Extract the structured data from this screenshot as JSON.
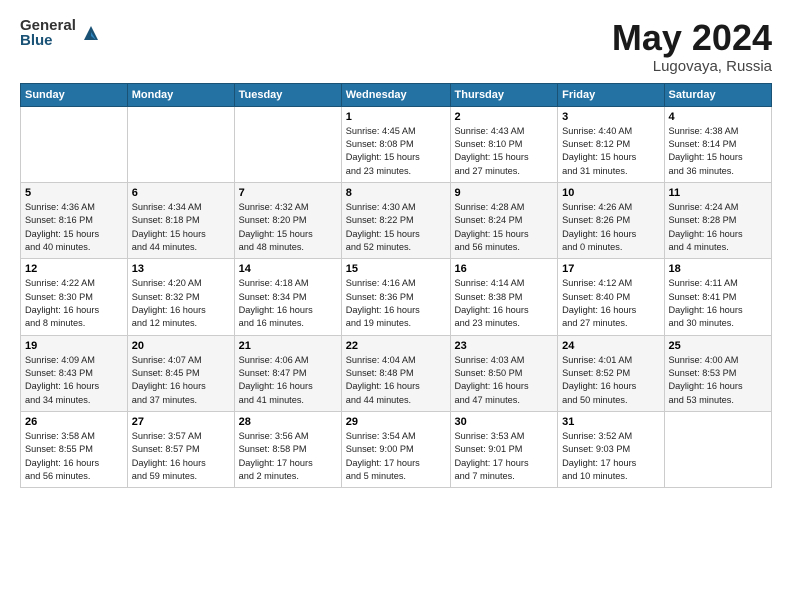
{
  "header": {
    "logo_general": "General",
    "logo_blue": "Blue",
    "month_year": "May 2024",
    "location": "Lugovaya, Russia"
  },
  "weekdays": [
    "Sunday",
    "Monday",
    "Tuesday",
    "Wednesday",
    "Thursday",
    "Friday",
    "Saturday"
  ],
  "weeks": [
    [
      {
        "day": "",
        "info": ""
      },
      {
        "day": "",
        "info": ""
      },
      {
        "day": "",
        "info": ""
      },
      {
        "day": "1",
        "info": "Sunrise: 4:45 AM\nSunset: 8:08 PM\nDaylight: 15 hours\nand 23 minutes."
      },
      {
        "day": "2",
        "info": "Sunrise: 4:43 AM\nSunset: 8:10 PM\nDaylight: 15 hours\nand 27 minutes."
      },
      {
        "day": "3",
        "info": "Sunrise: 4:40 AM\nSunset: 8:12 PM\nDaylight: 15 hours\nand 31 minutes."
      },
      {
        "day": "4",
        "info": "Sunrise: 4:38 AM\nSunset: 8:14 PM\nDaylight: 15 hours\nand 36 minutes."
      }
    ],
    [
      {
        "day": "5",
        "info": "Sunrise: 4:36 AM\nSunset: 8:16 PM\nDaylight: 15 hours\nand 40 minutes."
      },
      {
        "day": "6",
        "info": "Sunrise: 4:34 AM\nSunset: 8:18 PM\nDaylight: 15 hours\nand 44 minutes."
      },
      {
        "day": "7",
        "info": "Sunrise: 4:32 AM\nSunset: 8:20 PM\nDaylight: 15 hours\nand 48 minutes."
      },
      {
        "day": "8",
        "info": "Sunrise: 4:30 AM\nSunset: 8:22 PM\nDaylight: 15 hours\nand 52 minutes."
      },
      {
        "day": "9",
        "info": "Sunrise: 4:28 AM\nSunset: 8:24 PM\nDaylight: 15 hours\nand 56 minutes."
      },
      {
        "day": "10",
        "info": "Sunrise: 4:26 AM\nSunset: 8:26 PM\nDaylight: 16 hours\nand 0 minutes."
      },
      {
        "day": "11",
        "info": "Sunrise: 4:24 AM\nSunset: 8:28 PM\nDaylight: 16 hours\nand 4 minutes."
      }
    ],
    [
      {
        "day": "12",
        "info": "Sunrise: 4:22 AM\nSunset: 8:30 PM\nDaylight: 16 hours\nand 8 minutes."
      },
      {
        "day": "13",
        "info": "Sunrise: 4:20 AM\nSunset: 8:32 PM\nDaylight: 16 hours\nand 12 minutes."
      },
      {
        "day": "14",
        "info": "Sunrise: 4:18 AM\nSunset: 8:34 PM\nDaylight: 16 hours\nand 16 minutes."
      },
      {
        "day": "15",
        "info": "Sunrise: 4:16 AM\nSunset: 8:36 PM\nDaylight: 16 hours\nand 19 minutes."
      },
      {
        "day": "16",
        "info": "Sunrise: 4:14 AM\nSunset: 8:38 PM\nDaylight: 16 hours\nand 23 minutes."
      },
      {
        "day": "17",
        "info": "Sunrise: 4:12 AM\nSunset: 8:40 PM\nDaylight: 16 hours\nand 27 minutes."
      },
      {
        "day": "18",
        "info": "Sunrise: 4:11 AM\nSunset: 8:41 PM\nDaylight: 16 hours\nand 30 minutes."
      }
    ],
    [
      {
        "day": "19",
        "info": "Sunrise: 4:09 AM\nSunset: 8:43 PM\nDaylight: 16 hours\nand 34 minutes."
      },
      {
        "day": "20",
        "info": "Sunrise: 4:07 AM\nSunset: 8:45 PM\nDaylight: 16 hours\nand 37 minutes."
      },
      {
        "day": "21",
        "info": "Sunrise: 4:06 AM\nSunset: 8:47 PM\nDaylight: 16 hours\nand 41 minutes."
      },
      {
        "day": "22",
        "info": "Sunrise: 4:04 AM\nSunset: 8:48 PM\nDaylight: 16 hours\nand 44 minutes."
      },
      {
        "day": "23",
        "info": "Sunrise: 4:03 AM\nSunset: 8:50 PM\nDaylight: 16 hours\nand 47 minutes."
      },
      {
        "day": "24",
        "info": "Sunrise: 4:01 AM\nSunset: 8:52 PM\nDaylight: 16 hours\nand 50 minutes."
      },
      {
        "day": "25",
        "info": "Sunrise: 4:00 AM\nSunset: 8:53 PM\nDaylight: 16 hours\nand 53 minutes."
      }
    ],
    [
      {
        "day": "26",
        "info": "Sunrise: 3:58 AM\nSunset: 8:55 PM\nDaylight: 16 hours\nand 56 minutes."
      },
      {
        "day": "27",
        "info": "Sunrise: 3:57 AM\nSunset: 8:57 PM\nDaylight: 16 hours\nand 59 minutes."
      },
      {
        "day": "28",
        "info": "Sunrise: 3:56 AM\nSunset: 8:58 PM\nDaylight: 17 hours\nand 2 minutes."
      },
      {
        "day": "29",
        "info": "Sunrise: 3:54 AM\nSunset: 9:00 PM\nDaylight: 17 hours\nand 5 minutes."
      },
      {
        "day": "30",
        "info": "Sunrise: 3:53 AM\nSunset: 9:01 PM\nDaylight: 17 hours\nand 7 minutes."
      },
      {
        "day": "31",
        "info": "Sunrise: 3:52 AM\nSunset: 9:03 PM\nDaylight: 17 hours\nand 10 minutes."
      },
      {
        "day": "",
        "info": ""
      }
    ]
  ]
}
